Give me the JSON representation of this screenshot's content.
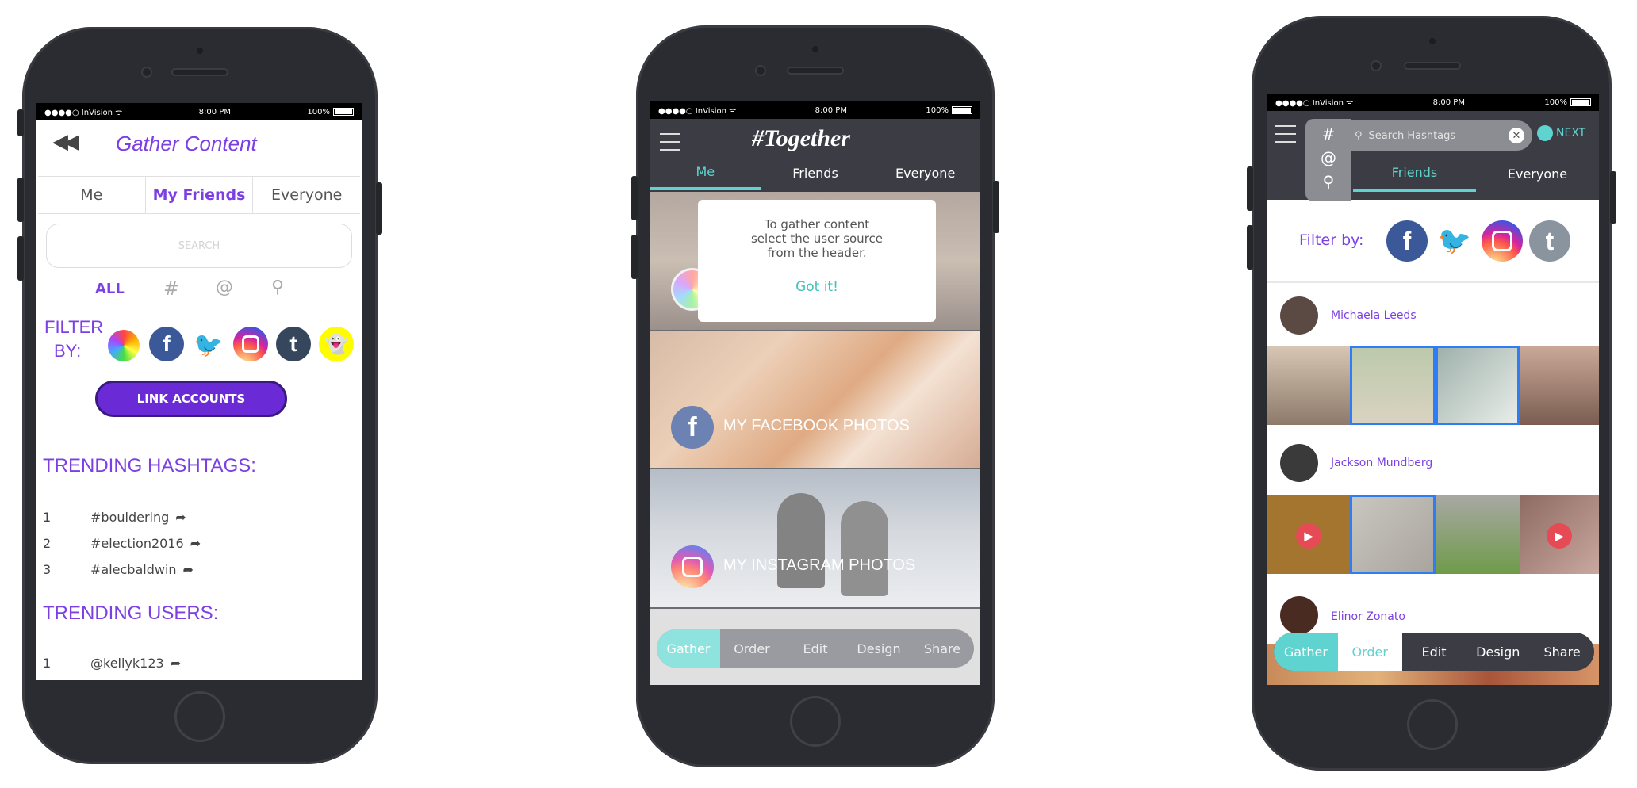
{
  "status": {
    "carrier": "●●●●○ InVision ᯤ",
    "time": "8:00 PM",
    "battery": "100%"
  },
  "screen1": {
    "back_icon": "rewind-icon",
    "title": "Gather Content",
    "tabs": [
      "Me",
      "My Friends",
      "Everyone"
    ],
    "active_tab": "My Friends",
    "search_placeholder": "SEARCH",
    "filter_types": [
      "ALL",
      "#",
      "@",
      "⚲"
    ],
    "filter_label_1": "FILTER",
    "filter_label_2": "BY:",
    "link_button": "LINK ACCOUNTS",
    "trending_hashtags_title": "TRENDING HASHTAGS:",
    "hashtags": [
      {
        "rank": "1",
        "tag": "#bouldering"
      },
      {
        "rank": "2",
        "tag": "#election2016"
      },
      {
        "rank": "3",
        "tag": "#alecbaldwin"
      }
    ],
    "trending_users_title": "TRENDING USERS:",
    "users": [
      {
        "rank": "1",
        "handle": "@kellyk123"
      }
    ]
  },
  "screen2": {
    "logo": "#Together",
    "tabs": [
      "Me",
      "Friends",
      "Everyone"
    ],
    "active_tab": "Me",
    "tooltip_line1": "To gather content",
    "tooltip_line2": "select the user source",
    "tooltip_line3": "from the header.",
    "tooltip_button": "Got it!",
    "sources": [
      "MY FACEBOOK PHOTOS",
      "MY INSTAGRAM PHOTOS"
    ],
    "steps": [
      "Gather",
      "Order",
      "Edit",
      "Design",
      "Share"
    ]
  },
  "screen3": {
    "header_symbols": [
      "#",
      "@",
      "⚲"
    ],
    "search_placeholder": "Search Hashtags",
    "next_label": "NEXT",
    "tabs": [
      "Friends",
      "Everyone"
    ],
    "active_tab": "Friends",
    "filter_label": "Filter by:",
    "people": [
      "Michaela Leeds",
      "Jackson Mundberg",
      "Elinor Zonato"
    ],
    "steps": [
      "Gather",
      "Order",
      "Edit",
      "Design",
      "Share"
    ]
  },
  "colors": {
    "accent_purple": "#7b3fe4",
    "accent_teal": "#5fd3cf",
    "facebook": "#3b5998",
    "twitter": "#1da1f2",
    "tumblr": "#36465d",
    "snapchat": "#fffc00"
  }
}
